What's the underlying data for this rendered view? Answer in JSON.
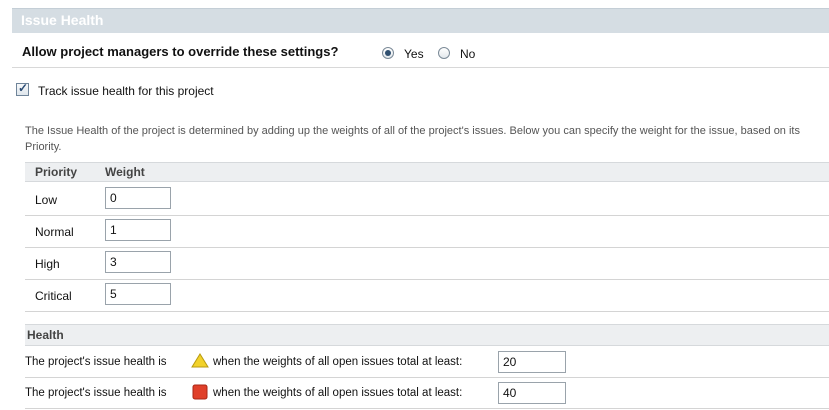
{
  "section": {
    "title": "Issue Health"
  },
  "override": {
    "question": "Allow project managers to override these settings?",
    "yes_label": "Yes",
    "no_label": "No",
    "selected": "Yes"
  },
  "track": {
    "label": "Track issue health for this project",
    "checked": true
  },
  "description": "The Issue Health of the project is determined by adding up the weights of all of the project's issues. Below you can specify the weight for the issue, based on its Priority.",
  "priority_table": {
    "headers": [
      "Priority",
      "Weight"
    ],
    "rows": [
      {
        "priority": "Low",
        "weight": "0"
      },
      {
        "priority": "Normal",
        "weight": "1"
      },
      {
        "priority": "High",
        "weight": "3"
      },
      {
        "priority": "Critical",
        "weight": "5"
      }
    ]
  },
  "health": {
    "title": "Health",
    "rows": [
      {
        "prefix": "The project's issue health is",
        "icon": "warning-triangle-icon",
        "color": "#f2d22a",
        "suffix": "when the weights of all open issues total at least:",
        "value": "20"
      },
      {
        "prefix": "The project's issue health is",
        "icon": "critical-square-icon",
        "color": "#e0402a",
        "suffix": "when the weights of all open issues total at least:",
        "value": "40"
      }
    ]
  }
}
